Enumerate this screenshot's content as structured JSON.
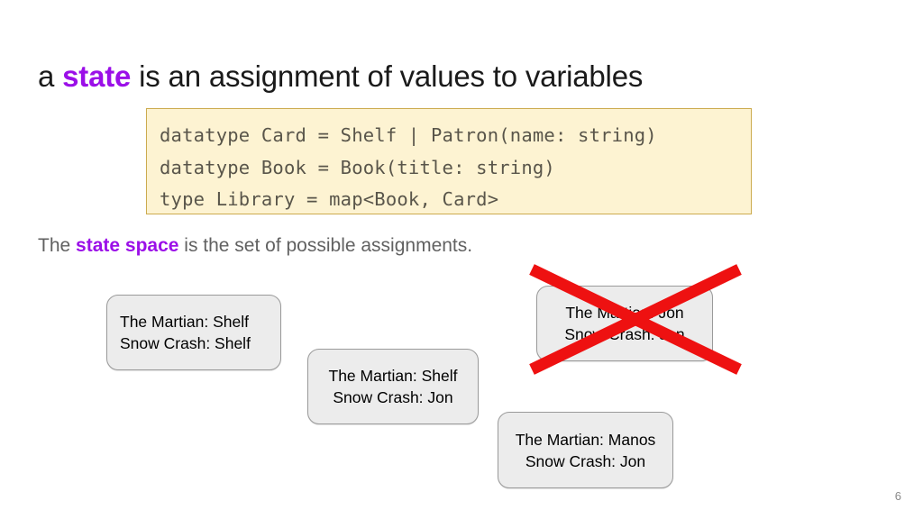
{
  "slide": {
    "title": {
      "prefix": "a ",
      "keyword": "state",
      "suffix": " is an assignment of values to variables"
    },
    "code_block": {
      "lines": [
        "datatype Card = Shelf | Patron(name: string)",
        "datatype Book = Book(title: string)",
        "type Library = map<Book, Card>"
      ],
      "background_color": "#fdf3d2",
      "border_color": "#ccab4e",
      "text_color": "#59554a"
    },
    "state_space_line": {
      "prefix": "The ",
      "keyword": "state space",
      "suffix": " is the set of possible assignments."
    },
    "state_boxes": [
      {
        "id": "state-box-1",
        "line1": "The Martian: Shelf",
        "line2": "Snow Crash: Shelf",
        "crossed_out": false
      },
      {
        "id": "state-box-2",
        "line1": "The Martian: Shelf",
        "line2": "Snow Crash: Jon",
        "crossed_out": false
      },
      {
        "id": "state-box-3",
        "line1": "The Martian: Jon",
        "line2": "Snow Crash: Jon",
        "crossed_out": true
      },
      {
        "id": "state-box-4",
        "line1": "The Martian: Manos",
        "line2": "Snow Crash: Jon",
        "crossed_out": false
      }
    ],
    "cross_out": {
      "color": "#ee1111",
      "stroke_width": 13
    },
    "page_number": "6",
    "colors": {
      "accent_purple": "#9b0fe8",
      "body_gray": "#616161",
      "box_fill": "#ececec",
      "box_border": "#9a9a9a"
    }
  }
}
